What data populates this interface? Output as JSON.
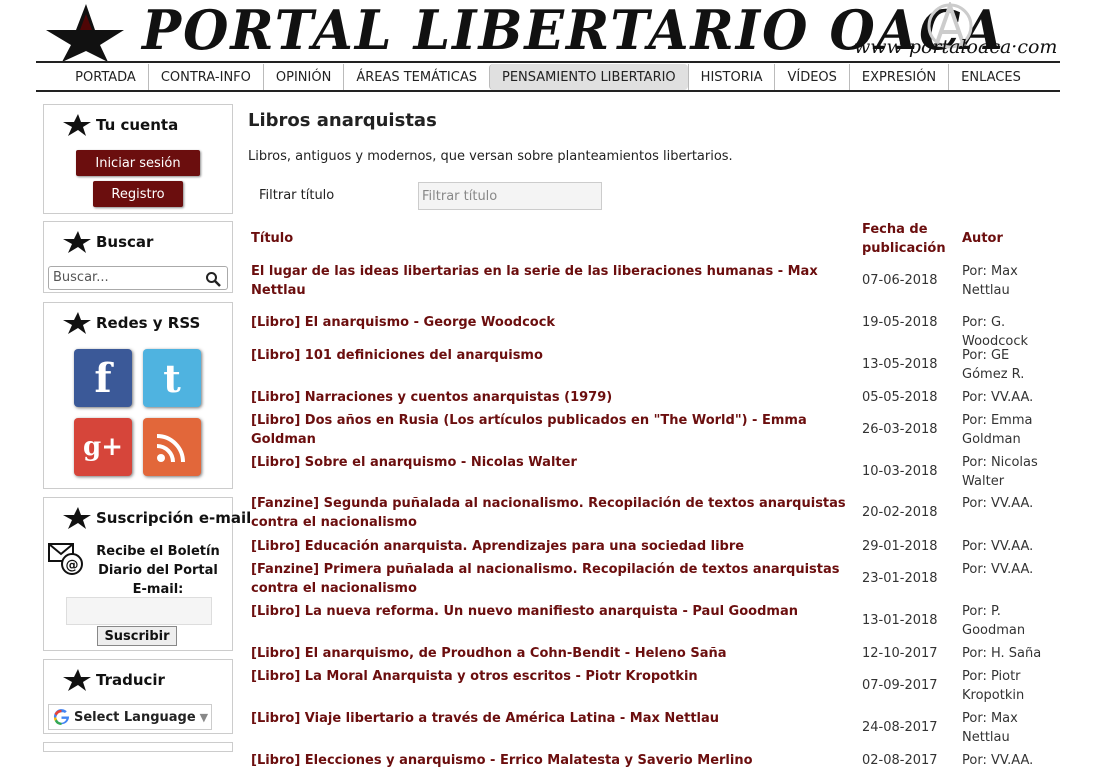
{
  "header": {
    "site_title": "PORTAL LIBERTARIO OACA",
    "site_url": "www·portaloaca·com"
  },
  "nav": [
    {
      "label": "PORTADA",
      "name": "portada"
    },
    {
      "label": "CONTRA-INFO",
      "name": "contra-info"
    },
    {
      "label": "OPINIÓN",
      "name": "opinion"
    },
    {
      "label": "ÁREAS TEMÁTICAS",
      "name": "areas-tematicas"
    },
    {
      "label": "PENSAMIENTO LIBERTARIO",
      "name": "pensamiento-libertario",
      "active": true
    },
    {
      "label": "HISTORIA",
      "name": "historia"
    },
    {
      "label": "VÍDEOS",
      "name": "videos"
    },
    {
      "label": "EXPRESIÓN",
      "name": "expresion"
    },
    {
      "label": "ENLACES",
      "name": "enlaces"
    }
  ],
  "sidebar": {
    "account": {
      "title": "Tu cuenta",
      "login_label": "Iniciar sesión",
      "register_label": "Registro"
    },
    "search": {
      "title": "Buscar",
      "placeholder": "Buscar..."
    },
    "social": {
      "title": "Redes y RSS"
    },
    "subscription": {
      "title": "Suscripción e-mail",
      "text_line1": "Recibe el Boletín",
      "text_line2": "Diario del Portal",
      "email_label": "E-mail:",
      "subscribe_label": "Suscribir"
    },
    "translate": {
      "title": "Traducir",
      "select_label": "Select Language"
    }
  },
  "main": {
    "title": "Libros anarquistas",
    "intro": "Libros, antiguos y modernos, que versan sobre planteamientos libertarios.",
    "filter_label": "Filtrar título",
    "filter_placeholder": "Filtrar título",
    "columns": {
      "title": "Título",
      "date_line1": "Fecha de",
      "date_line2": "publicación",
      "author": "Autor"
    },
    "rows": [
      {
        "title": "El lugar de las ideas libertarias en la serie de las liberaciones humanas - Max Nettlau",
        "date": "07-06-2018",
        "author": "Por: Max Nettlau"
      },
      {
        "title": "[Libro] El anarquismo - George Woodcock",
        "date": "19-05-2018",
        "author": "Por: G. Woodcock"
      },
      {
        "title": "[Libro] 101 definiciones del anarquismo",
        "date": "13-05-2018",
        "author": "Por: GE Gómez R."
      },
      {
        "title": "[Libro] Narraciones y cuentos anarquistas (1979)",
        "date": "05-05-2018",
        "author": "Por: VV.AA."
      },
      {
        "title": "[Libro] Dos años en Rusia (Los artículos publicados en \"The World\") - Emma Goldman",
        "date": "26-03-2018",
        "author": "Por: Emma Goldman"
      },
      {
        "title": "[Libro] Sobre el anarquismo - Nicolas Walter",
        "date": "10-03-2018",
        "author": "Por: Nicolas Walter"
      },
      {
        "title": "[Fanzine] Segunda puñalada al nacionalismo. Recopilación de textos anarquistas contra el nacionalismo",
        "date": "20-02-2018",
        "author": "Por: VV.AA."
      },
      {
        "title": "[Libro] Educación anarquista. Aprendizajes para una sociedad libre",
        "date": "29-01-2018",
        "author": "Por: VV.AA."
      },
      {
        "title": "[Fanzine] Primera puñalada al nacionalismo. Recopilación de textos anarquistas contra el nacionalismo",
        "date": "23-01-2018",
        "author": "Por: VV.AA."
      },
      {
        "title": "[Libro] La nueva reforma. Un nuevo manifiesto anarquista - Paul Goodman",
        "date": "13-01-2018",
        "author": "Por: P. Goodman"
      },
      {
        "title": "[Libro] El anarquismo, de Proudhon a Cohn-Bendit - Heleno Saña",
        "date": "12-10-2017",
        "author": "Por: H. Saña"
      },
      {
        "title": "[Libro] La Moral Anarquista y otros escritos - Piotr Kropotkin",
        "date": "07-09-2017",
        "author": "Por: Piotr Kropotkin"
      },
      {
        "title": "[Libro] Viaje libertario a través de América Latina - Max Nettlau",
        "date": "24-08-2017",
        "author": "Por: Max Nettlau"
      },
      {
        "title": "[Libro] Elecciones y anarquismo - Errico Malatesta y Saverio Merlino",
        "date": "02-08-2017",
        "author": "Por: VV.AA."
      }
    ]
  }
}
